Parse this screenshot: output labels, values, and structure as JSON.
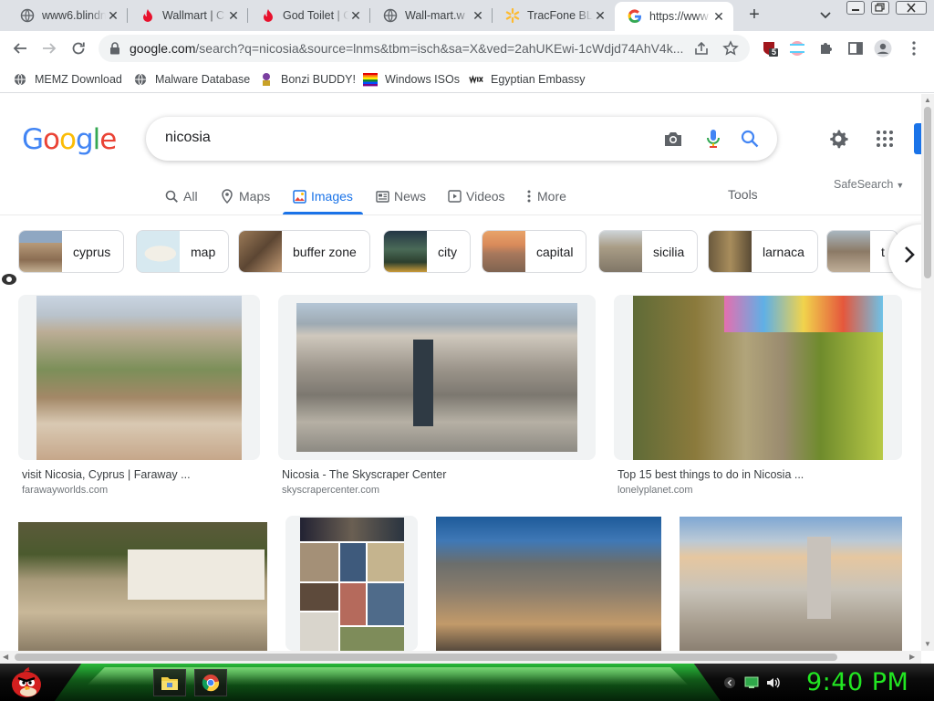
{
  "browser": {
    "tabs": [
      {
        "title": "www6.blindn",
        "icon": "globe-icon"
      },
      {
        "title": "Wallmart | C",
        "icon": "flame-icon"
      },
      {
        "title": "God Toilet | C",
        "icon": "flame-icon"
      },
      {
        "title": "Wall-mart.w",
        "icon": "globe-icon"
      },
      {
        "title": "TracFone BL",
        "icon": "sparkle-icon"
      },
      {
        "title": "https://www",
        "icon": "google-g-icon",
        "active": true
      }
    ],
    "new_tab": "+",
    "url_host": "google.com",
    "url_rest": "/search?q=nicosia&source=lnms&tbm=isch&sa=X&ved=2ahUKEwi-1cWdjd74AhV4k...",
    "extension_badge": "5"
  },
  "bookmarks": [
    {
      "label": "MEMZ Download",
      "icon": "globe-icon"
    },
    {
      "label": "Malware Database",
      "icon": "globe-icon"
    },
    {
      "label": "Bonzi BUDDY!",
      "icon": "bonzi-icon"
    },
    {
      "label": "Windows ISOs",
      "icon": "windows-flag-icon"
    },
    {
      "label": "Egyptian Embassy",
      "icon": "wix-icon"
    }
  ],
  "google": {
    "logo_letters": [
      "G",
      "o",
      "o",
      "g",
      "l",
      "e"
    ],
    "logo_colors": [
      "#4285f4",
      "#ea4335",
      "#fbbc05",
      "#4285f4",
      "#34a853",
      "#ea4335"
    ],
    "query": "nicosia",
    "accent": "#1a73e8"
  },
  "filter_tabs": [
    {
      "label": "All",
      "icon": "search-icon"
    },
    {
      "label": "Maps",
      "icon": "map-pin-icon"
    },
    {
      "label": "Images",
      "icon": "image-icon",
      "active": true
    },
    {
      "label": "News",
      "icon": "news-icon"
    },
    {
      "label": "Videos",
      "icon": "video-icon"
    },
    {
      "label": "More",
      "icon": "more-vert-icon"
    }
  ],
  "tools_label": "Tools",
  "safesearch_label": "SafeSearch",
  "chips": [
    "cyprus",
    "map",
    "buffer zone",
    "city",
    "capital",
    "sicilia",
    "larnaca",
    "t"
  ],
  "results_row1": [
    {
      "title": "visit Nicosia, Cyprus | Faraway ...",
      "source": "farawayworlds.com"
    },
    {
      "title": "Nicosia - The Skyscraper Center",
      "source": "skyscrapercenter.com"
    },
    {
      "title": "Top 15 best things to do in Nicosia ...",
      "source": "lonelyplanet.com"
    }
  ],
  "taskbar": {
    "time": "9:40 PM",
    "clock_color": "#22e622"
  }
}
